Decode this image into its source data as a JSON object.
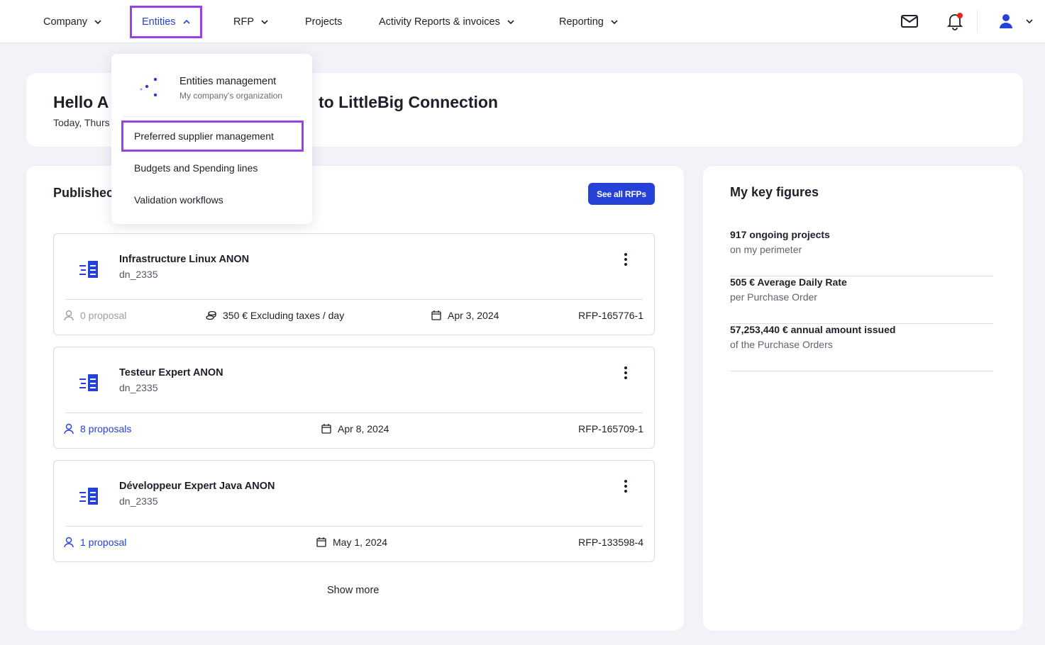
{
  "nav": {
    "items": [
      {
        "label": "Company"
      },
      {
        "label": "Entities"
      },
      {
        "label": "RFP"
      },
      {
        "label": "Projects"
      },
      {
        "label": "Activity Reports & invoices"
      },
      {
        "label": "Reporting"
      }
    ],
    "icons": [
      "mail-icon",
      "bell-icon",
      "user-icon",
      "chevron-down-icon"
    ],
    "notification_color": "#e8221c"
  },
  "dropdown": {
    "header_title": "Entities management",
    "header_sub": "My company's organization",
    "items": [
      {
        "label": "Preferred supplier management"
      },
      {
        "label": "Budgets and Spending lines"
      },
      {
        "label": "Validation workflows"
      }
    ]
  },
  "hello": {
    "title_start": "Hello A",
    "title_end": "to LittleBig Connection",
    "date": "Today, Thurs"
  },
  "rfps": {
    "heading": "Publishec",
    "see_all": "See all RFPs",
    "items": [
      {
        "title": "Infrastructure Linux ANON",
        "sub": "dn_2335",
        "proposals": "0 proposal",
        "rate": "350 € Excluding taxes / day",
        "date": "Apr 3, 2024",
        "ref": "RFP-165776-1"
      },
      {
        "title": "Testeur Expert ANON",
        "sub": "dn_2335",
        "proposals": "8 proposals",
        "date": "Apr 8, 2024",
        "ref": "RFP-165709-1"
      },
      {
        "title": "Développeur Expert Java ANON",
        "sub": "dn_2335",
        "proposals": "1 proposal",
        "date": "May 1, 2024",
        "ref": "RFP-133598-4"
      }
    ],
    "show_more": "Show more"
  },
  "key_figures": {
    "heading": "My key figures",
    "items": [
      {
        "main": "917 ongoing projects",
        "sub": "on my perimeter"
      },
      {
        "main": "505 € Average Daily Rate",
        "sub": "per Purchase Order"
      },
      {
        "main": "57,253,440 € annual amount issued",
        "sub": "of the Purchase Orders"
      }
    ]
  },
  "colors": {
    "accent": "#2541d8",
    "highlight": "#9b3fe6"
  }
}
